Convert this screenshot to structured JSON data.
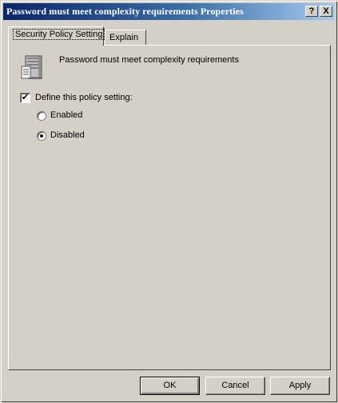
{
  "window": {
    "title": "Password must meet complexity requirements Properties",
    "help_label": "?",
    "close_label": "X"
  },
  "tabs": [
    {
      "label": "Security Policy Setting",
      "active": true
    },
    {
      "label": "Explain",
      "active": false
    }
  ],
  "policy": {
    "icon": "server-policy-icon",
    "name": "Password must meet complexity requirements",
    "define_label": "Define this policy setting:",
    "define_checked": true,
    "check_mark": "✔",
    "options": [
      {
        "label": "Enabled",
        "selected": false
      },
      {
        "label": "Disabled",
        "selected": true
      }
    ]
  },
  "buttons": {
    "ok": "OK",
    "cancel": "Cancel",
    "apply": "Apply"
  },
  "colors": {
    "face": "#d4d0c8",
    "title_start": "#0a246a",
    "title_end": "#a6caf0"
  }
}
